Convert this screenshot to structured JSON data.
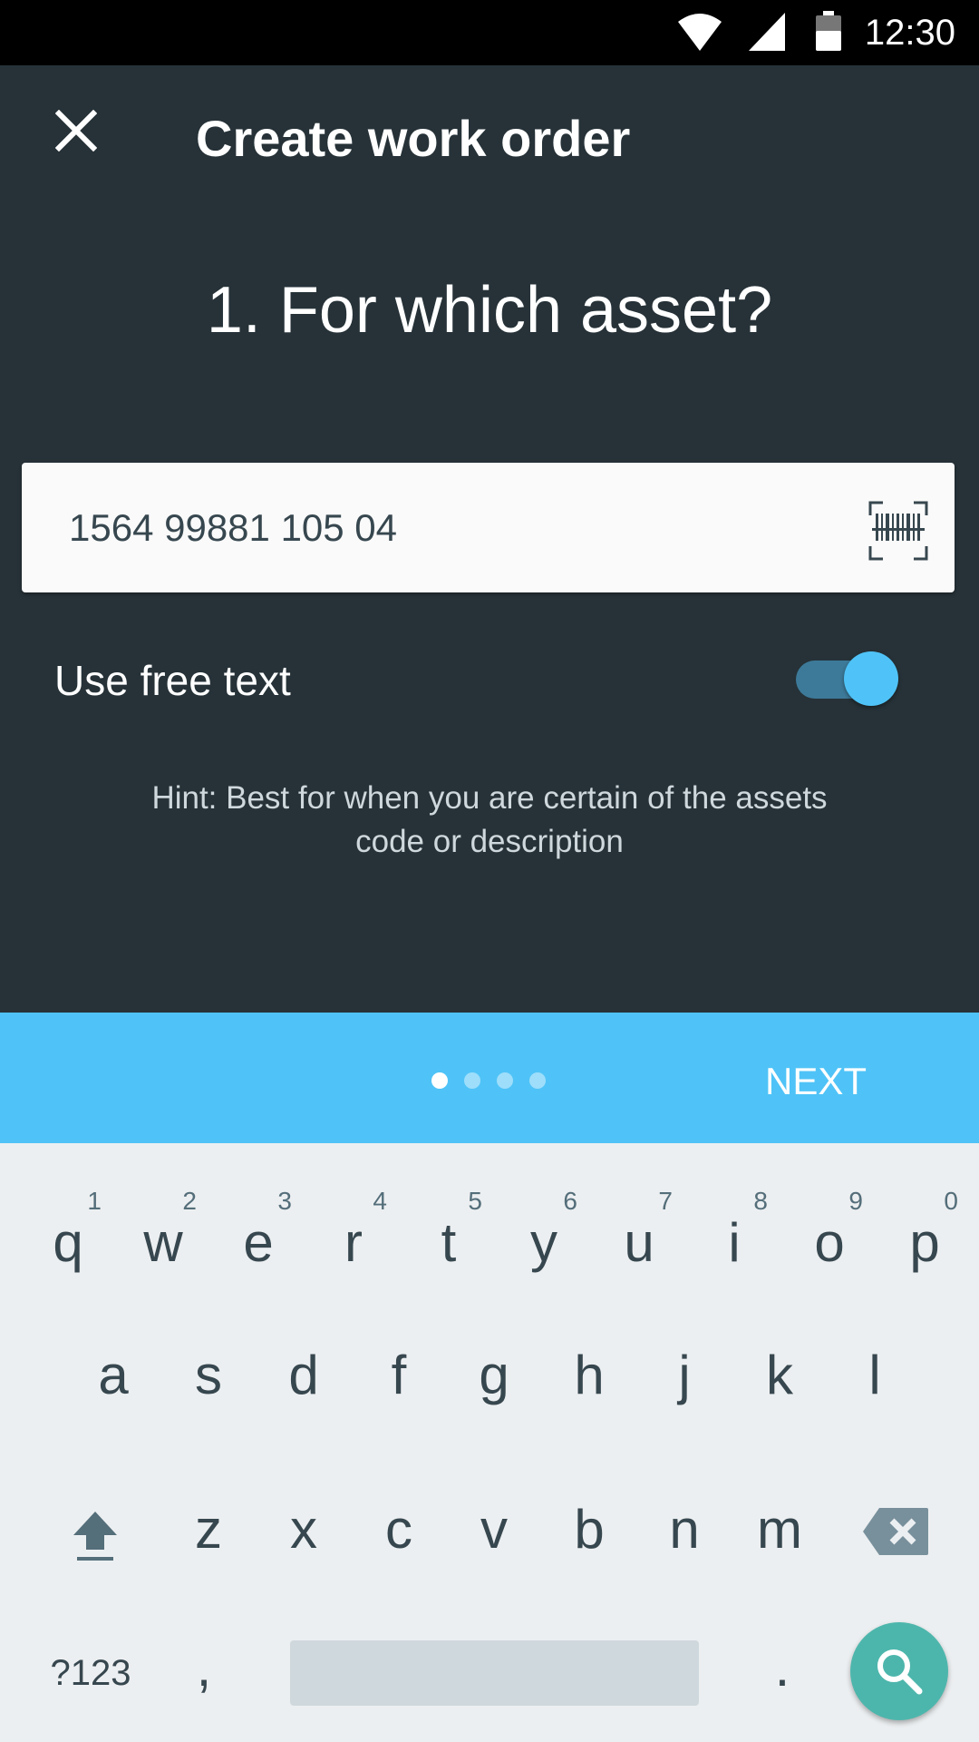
{
  "status_bar": {
    "time": "12:30"
  },
  "toolbar": {
    "title": "Create work order"
  },
  "step": {
    "title": "1. For which asset?"
  },
  "asset_field": {
    "value": "1564 99881 105 04"
  },
  "free_text": {
    "label": "Use free text",
    "enabled": true
  },
  "hint": {
    "text": "Hint: Best for when you are certain of the assets code or description"
  },
  "pager": {
    "total": 4,
    "current": 1,
    "next_label": "NEXT"
  },
  "keyboard": {
    "row1": [
      {
        "letter": "q",
        "num": "1"
      },
      {
        "letter": "w",
        "num": "2"
      },
      {
        "letter": "e",
        "num": "3"
      },
      {
        "letter": "r",
        "num": "4"
      },
      {
        "letter": "t",
        "num": "5"
      },
      {
        "letter": "y",
        "num": "6"
      },
      {
        "letter": "u",
        "num": "7"
      },
      {
        "letter": "i",
        "num": "8"
      },
      {
        "letter": "o",
        "num": "9"
      },
      {
        "letter": "p",
        "num": "0"
      }
    ],
    "row2": [
      "a",
      "s",
      "d",
      "f",
      "g",
      "h",
      "j",
      "k",
      "l"
    ],
    "row3": [
      "z",
      "x",
      "c",
      "v",
      "b",
      "n",
      "m"
    ],
    "symbols_label": "?123",
    "comma_label": ",",
    "period_label": "."
  },
  "colors": {
    "background": "#263238",
    "accent": "#4fc3f7",
    "fab": "#4db6ac",
    "keyboard_bg": "#eceff1"
  }
}
